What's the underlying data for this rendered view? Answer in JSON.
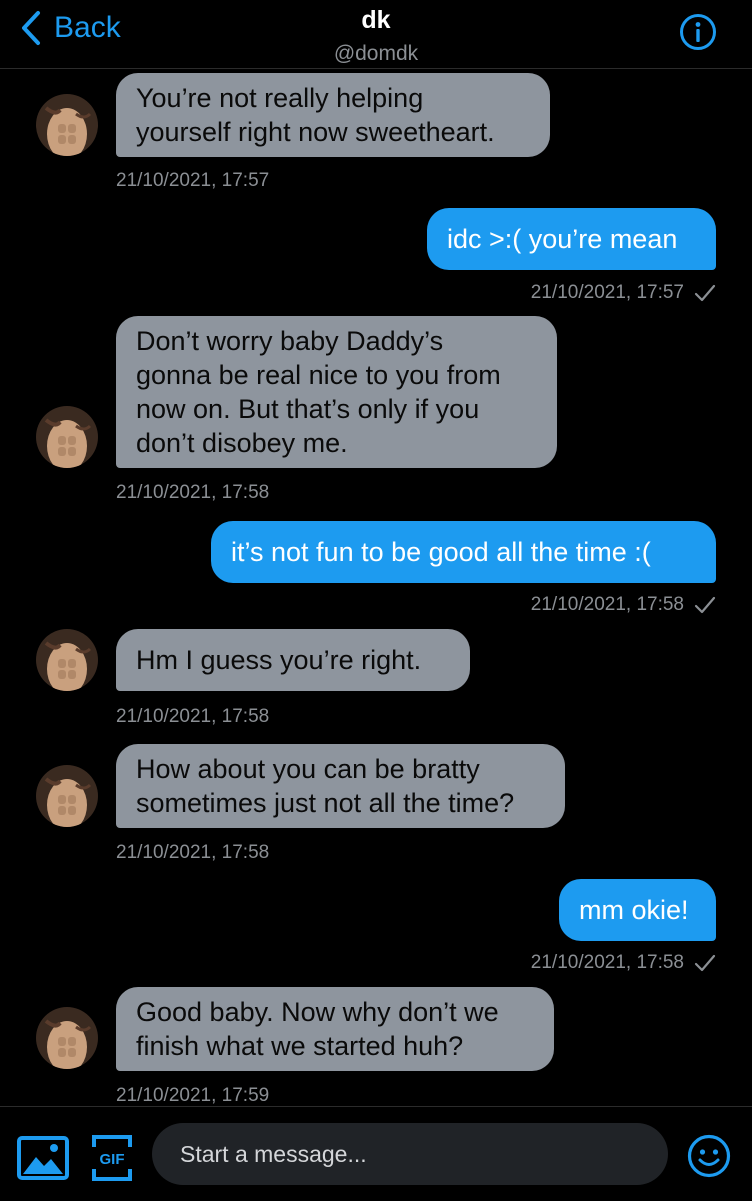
{
  "header": {
    "back_label": "Back",
    "title": "dk",
    "handle": "@domdk",
    "back_icon": "chevron-left-icon",
    "info_icon": "info-icon"
  },
  "colors": {
    "accent": "#1d9bf0",
    "incoming_bubble": "#8e959e",
    "background": "#000000",
    "muted_text": "#8b8f94"
  },
  "messages": [
    {
      "from": "them",
      "lines": [
        "You’re not really helping",
        "yourself right now sweetheart."
      ],
      "time": "21/10/2021, 17:57"
    },
    {
      "from": "me",
      "lines": [
        "idc >:( you’re mean"
      ],
      "time": "21/10/2021, 17:57",
      "status_icon": "checkmark-icon"
    },
    {
      "from": "them",
      "lines": [
        "Don’t worry baby Daddy’s",
        "gonna be real nice to you from",
        "now on. But that’s only if you",
        "don’t disobey me."
      ],
      "time": "21/10/2021, 17:58"
    },
    {
      "from": "me",
      "lines": [
        "it’s not fun to be good all the time :("
      ],
      "time": "21/10/2021, 17:58",
      "status_icon": "checkmark-icon"
    },
    {
      "from": "them",
      "lines": [
        "Hm I guess you’re right."
      ],
      "time": "21/10/2021, 17:58"
    },
    {
      "from": "them",
      "lines": [
        "How about you can be bratty",
        "sometimes just not all the time?"
      ],
      "time": "21/10/2021, 17:58"
    },
    {
      "from": "me",
      "lines": [
        "mm okie!"
      ],
      "time": "21/10/2021, 17:58",
      "status_icon": "checkmark-icon"
    },
    {
      "from": "them",
      "lines": [
        "Good baby. Now why don’t we",
        "finish what we started huh?"
      ],
      "time": "21/10/2021, 17:59"
    }
  ],
  "composer": {
    "placeholder": "Start a message...",
    "gif_label": "GIF",
    "media_icon": "image-icon",
    "emoji_icon": "emoji-icon"
  }
}
